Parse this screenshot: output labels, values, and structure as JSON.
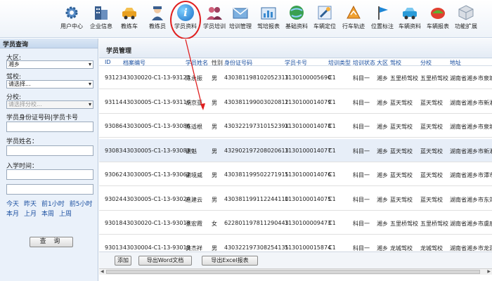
{
  "toolbar": {
    "items": [
      {
        "label": "用户中心",
        "icon": "gear-icon"
      },
      {
        "label": "企业信息",
        "icon": "building-icon"
      },
      {
        "label": "教练车",
        "icon": "car-icon"
      },
      {
        "label": "教练员",
        "icon": "coach-icon"
      },
      {
        "label": "学员资料",
        "icon": "info-icon"
      },
      {
        "label": "学员培训",
        "icon": "people-icon"
      },
      {
        "label": "培训管理",
        "icon": "envelope-icon"
      },
      {
        "label": "驾培报表",
        "icon": "chart-icon"
      },
      {
        "label": "基础资料",
        "icon": "globe-icon"
      },
      {
        "label": "车辆定位",
        "icon": "satellite-icon"
      },
      {
        "label": "行车轨迹",
        "icon": "route-icon"
      },
      {
        "label": "位置标注",
        "icon": "flag-icon"
      },
      {
        "label": "车辆资料",
        "icon": "car-data-icon"
      },
      {
        "label": "车辆报表",
        "icon": "car-report-icon"
      },
      {
        "label": "功能扩展",
        "icon": "box-icon"
      }
    ],
    "active_glyph": "i"
  },
  "left": {
    "title": "学员查询",
    "district_label": "大区:",
    "district_value": "湘乡",
    "school_label": "驾校:",
    "school_value": "请选择...",
    "branch_label": "分校:",
    "branch_placeholder": "请选择分校...",
    "id_label": "学员身份证号码|学员卡号",
    "name_label": "学员姓名：",
    "date_label": "入学时间：",
    "quick_row1": [
      "今天",
      "昨天",
      "前1小时",
      "前5小时"
    ],
    "quick_row2": [
      "本月",
      "上月",
      "本周",
      "上周"
    ],
    "search_button": "查 询"
  },
  "main": {
    "title": "学员管理",
    "columns": [
      "ID",
      "档案编号",
      "学员姓名",
      "性别",
      "身份证号码",
      "学员卡号",
      "培训类型",
      "培训状态",
      "大区",
      "驾校",
      "分校",
      "地址"
    ],
    "rows": [
      [
        "93123",
        "43030020-C1-13-93123",
        "陈永振",
        "男",
        "430381198102052313",
        "1130100005690",
        "C1",
        "科目一",
        "湘乡",
        "五里桥驾校",
        "五里桥驾校",
        "湖南省湘乡市泉塘"
      ],
      [
        "93114",
        "43030005-C1-13-93114",
        "胡京亚",
        "男",
        "430381199003020812",
        "1130100014079",
        "C1",
        "科目一",
        "湘乡",
        "蓝天驾校",
        "蓝天驾校",
        "湖南省湘乡市新湘"
      ],
      [
        "93086",
        "43030005-C1-13-93086",
        "陈适根",
        "男",
        "43032219731015239X",
        "1130100014078",
        "C1",
        "科目一",
        "湘乡",
        "蓝天驾校",
        "蓝天驾校",
        "湖南省湘乡市泉塘"
      ],
      [
        "93083",
        "43030005-C1-13-93083",
        "谢魁",
        "男",
        "432902197208020613",
        "1130100014077",
        "C1",
        "科目一",
        "湘乡",
        "蓝天驾校",
        "蓝天驾校",
        "湖南省湘乡市新湘"
      ],
      [
        "93062",
        "43030005-C1-13-93062",
        "谢境威",
        "男",
        "430381199502271915",
        "1130100014076",
        "C1",
        "科目一",
        "湘乡",
        "蓝天驾校",
        "蓝天驾校",
        "湖南省湘乡市潭市"
      ],
      [
        "93024",
        "43030005-C1-13-93024",
        "赵建云",
        "男",
        "430381199112244110",
        "1130100014075",
        "C1",
        "科目一",
        "湘乡",
        "蓝天驾校",
        "蓝天驾校",
        "湖南省湘乡市东郊"
      ],
      [
        "93018",
        "43030020-C1-13-93018",
        "张宏霞",
        "女",
        "622801197811290443",
        "1130100009473",
        "C1",
        "科目一",
        "湘乡",
        "五里桥驾校",
        "五里桥驾校",
        "湖南省湘乡市虞唐"
      ],
      [
        "93013",
        "43030004-C1-13-93013",
        "黄杰祥",
        "男",
        "430322197308254135",
        "1130100015874",
        "C1",
        "科目一",
        "湘乡",
        "龙城驾校",
        "龙城驾校",
        "湖南省湘乡市龙洞"
      ]
    ],
    "buttons": {
      "add": "添加",
      "word": "导出Word文档",
      "excel": "导出Excel报表"
    }
  },
  "colors": {
    "accent": "#1a4fa0",
    "highlight_ring": "#e02020",
    "panel_bg": "#eaf1fa"
  }
}
